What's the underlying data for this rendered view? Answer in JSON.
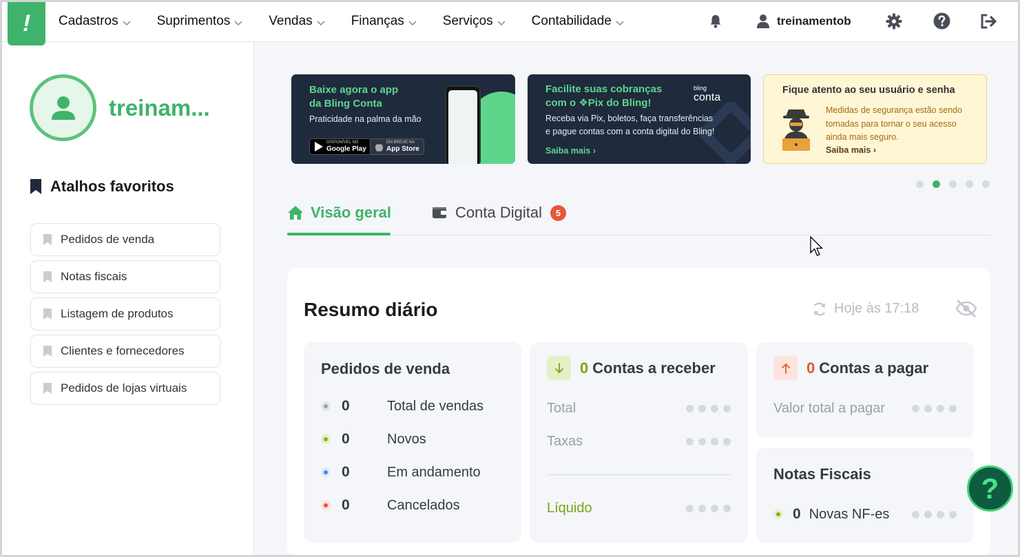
{
  "nav": {
    "menu": [
      {
        "label": "Cadastros"
      },
      {
        "label": "Suprimentos"
      },
      {
        "label": "Vendas"
      },
      {
        "label": "Finanças"
      },
      {
        "label": "Serviços"
      },
      {
        "label": "Contabilidade"
      }
    ],
    "username": "treinamentob",
    "icons": [
      "bell-icon",
      "user-icon",
      "gear-icon",
      "help-icon",
      "logout-icon"
    ]
  },
  "sidebar": {
    "username_short": "treinam...",
    "favorites_title": "Atalhos favoritos",
    "favorites": [
      {
        "label": "Pedidos de venda"
      },
      {
        "label": "Notas fiscais"
      },
      {
        "label": "Listagem de produtos"
      },
      {
        "label": "Clientes e fornecedores"
      },
      {
        "label": "Pedidos de lojas virtuais"
      }
    ]
  },
  "banners": {
    "app": {
      "title_line1": "Baixe agora o app",
      "title_line2": "da Bling Conta",
      "text": "Praticidade na palma da mão",
      "google_small": "DISPONÍVEL NO",
      "google": "Google Play",
      "apple_small": "EM BREVE NA",
      "apple": "App Store"
    },
    "pix": {
      "title_line1": "Facilite suas cobranças",
      "title_line2": "com o ❖Pix do Bling!",
      "brand_small": "bling",
      "brand": "conta",
      "text_line1": "Receba via Pix, boletos, faça transferências",
      "text_line2": "e pague contas com a conta digital do Bling!",
      "link": "Saiba mais"
    },
    "security": {
      "title": "Fique atento ao seu usuário e senha",
      "text_line1": "Medidas de segurança estão sendo",
      "text_line2": "tomadas para tornar o seu acesso",
      "text_line3": "ainda mais seguro.",
      "link": "Saiba mais"
    },
    "active_dot": 1
  },
  "tabs": {
    "overview": "Visão geral",
    "digital": "Conta Digital",
    "digital_badge": "5"
  },
  "summary": {
    "title": "Resumo diário",
    "updated": "Hoje às 17:18",
    "orders": {
      "title": "Pedidos de venda",
      "rows": [
        {
          "count": "0",
          "label": "Total de vendas",
          "color": "#9aa1aa"
        },
        {
          "count": "0",
          "label": "Novos",
          "color": "#8aad1e"
        },
        {
          "count": "0",
          "label": "Em andamento",
          "color": "#3d8fe0"
        },
        {
          "count": "0",
          "label": "Cancelados",
          "color": "#e8553b"
        }
      ]
    },
    "receivable": {
      "count": "0",
      "title": "Contas a receber",
      "total": "Total",
      "fees": "Taxas",
      "net": "Líquido"
    },
    "payable": {
      "count": "0",
      "title": "Contas a pagar",
      "total": "Valor total a pagar"
    },
    "invoices": {
      "title": "Notas Fiscais",
      "count": "0",
      "label": "Novas NF-es"
    }
  },
  "fab": {
    "label": "?"
  },
  "colors": {
    "brand": "#3fb36a",
    "dark_banner": "#1f2a3d",
    "warning_banner": "#fff6d5",
    "receivable": "#7ba21c",
    "payable": "#e05a34"
  }
}
